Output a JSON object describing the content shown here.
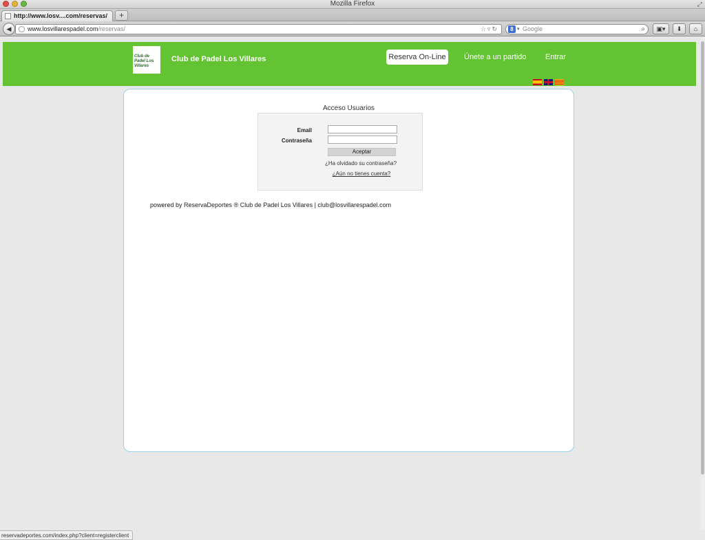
{
  "window": {
    "title": "Mozilla Firefox"
  },
  "tabs": [
    {
      "label": "http://www.losv....com/reservas/"
    }
  ],
  "toolbar": {
    "url_domain": "www.losvillarespadel.com",
    "url_path": "/reservas/",
    "search_placeholder": "Google",
    "search_engine_letter": "8"
  },
  "site": {
    "name": "Club de Padel Los Villares",
    "logo_text": "Club de Padel Los Villares",
    "nav": {
      "reserva": "Reserva On-Line",
      "unete": "Únete a un partido",
      "entrar": "Entrar"
    }
  },
  "login": {
    "title": "Acceso Usuarios",
    "email_label": "Email",
    "password_label": "Contraseña",
    "email_value": "",
    "password_value": "",
    "accept_label": "Aceptar",
    "forgot_link": "¿Ha olvidado su contraseña?",
    "register_link": "¿Aún no tienes cuenta?"
  },
  "footer": {
    "text": "powered by ReservaDeportes ® Club de Padel Los Villares | club@losvillarespadel.com"
  },
  "status": {
    "url": "reservadeportes.com/index.php?client=registerclient"
  },
  "colors": {
    "header_green": "#63c333",
    "card_border": "#9bd3e8"
  }
}
